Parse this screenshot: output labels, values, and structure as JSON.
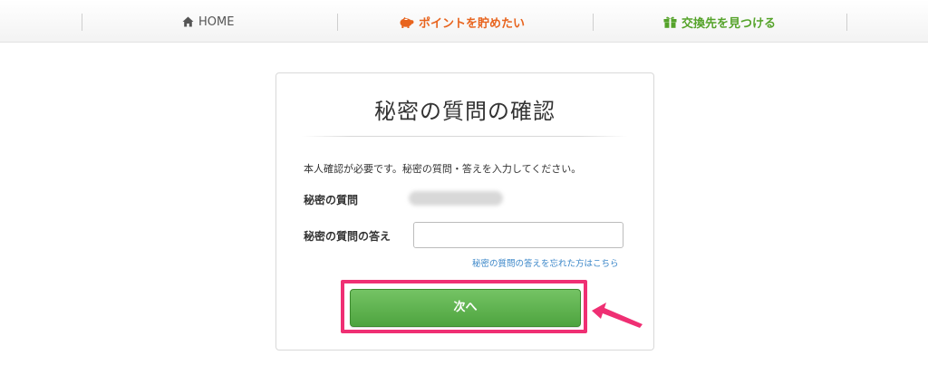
{
  "nav": {
    "home_label": "HOME",
    "save_label": "ポイントを貯めたい",
    "exchange_label": "交換先を見つける"
  },
  "card": {
    "title": "秘密の質問の確認",
    "instruction": "本人確認が必要です。秘密の質問・答えを入力してください。",
    "question_label": "秘密の質問",
    "answer_label": "秘密の質問の答え",
    "answer_value": "",
    "forgot_link": "秘密の質問の答えを忘れた方はこちら",
    "next_button": "次へ"
  },
  "colors": {
    "accent_orange": "#e8641e",
    "accent_green": "#55a32a",
    "button_green": "#5aad4a",
    "highlight_pink": "#ef2f73",
    "link_blue": "#3a86c8"
  },
  "icons": {
    "home": "home-icon",
    "save": "piggy-bank-icon",
    "exchange": "gift-icon",
    "annotation": "arrow-pointer-icon"
  }
}
